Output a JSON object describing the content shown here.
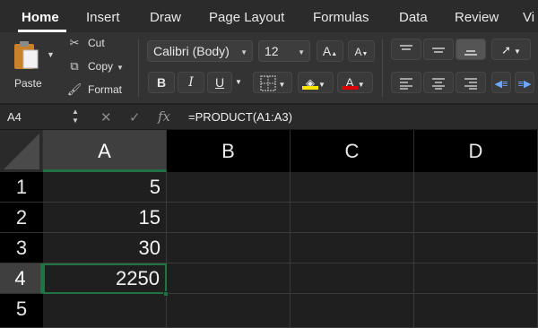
{
  "ribbon_tabs": [
    "Home",
    "Insert",
    "Draw",
    "Page Layout",
    "Formulas",
    "Data",
    "Review",
    "Vi"
  ],
  "clipboard": {
    "paste_label": "Paste",
    "cut_label": "Cut",
    "copy_label": "Copy",
    "format_label": "Format"
  },
  "font": {
    "family_value": "Calibri (Body)",
    "size_value": "12",
    "grow_label": "A",
    "shrink_label": "A",
    "bold_label": "B",
    "italic_label": "I",
    "underline_label": "U",
    "font_color_label": "A",
    "highlight_color": "#ffe600",
    "font_color": "#e00000"
  },
  "formula_bar": {
    "name_box": "A4",
    "fx_label": "fx",
    "formula": "=PRODUCT(A1:A3)"
  },
  "sheet": {
    "columns": [
      "A",
      "B",
      "C",
      "D"
    ],
    "rows": [
      "1",
      "2",
      "3",
      "4",
      "5"
    ],
    "cells_A": [
      "5",
      "15",
      "30",
      "2250",
      ""
    ],
    "active_cell": "A4",
    "accent": "#217346"
  }
}
